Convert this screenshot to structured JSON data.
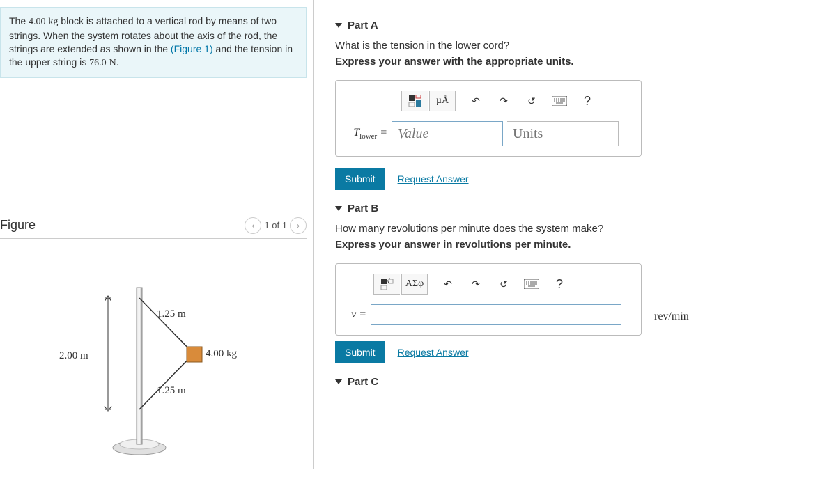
{
  "problem": {
    "mass": "4.00",
    "mass_unit": "kg",
    "text_before_fig": "The 4.00 kg block is attached to a vertical rod by means of two strings. When the system rotates about the axis of the rod, the strings are extended as shown in the ",
    "fig_link_text": "(Figure 1)",
    "text_after_fig": " and the tension in the upper string is 76.0 N.",
    "upper_tension": "76.0",
    "tension_unit": "N"
  },
  "figure": {
    "title": "Figure",
    "pager": "1 of 1",
    "dim_total": "2.00 m",
    "dim_upper": "1.25 m",
    "dim_lower": "1.25 m",
    "block_label": "4.00 kg"
  },
  "partA": {
    "header": "Part A",
    "question": "What is the tension in the lower cord?",
    "instruction": "Express your answer with the appropriate units.",
    "var_label": "Tlower",
    "value_placeholder": "Value",
    "units_placeholder": "Units",
    "submit": "Submit",
    "request": "Request Answer",
    "toolbar": {
      "units_btn": "µÅ",
      "undo": "↶",
      "redo": "↷",
      "reset": "↺",
      "keyboard": "⌨",
      "help": "?"
    }
  },
  "partB": {
    "header": "Part B",
    "question": "How many revolutions per minute does the system make?",
    "instruction": "Express your answer in revolutions per minute.",
    "var_label": "ν =",
    "unit_suffix": "rev/min",
    "submit": "Submit",
    "request": "Request Answer",
    "toolbar": {
      "symbols": "ΑΣφ",
      "undo": "↶",
      "redo": "↷",
      "reset": "↺",
      "keyboard": "⌨",
      "help": "?"
    }
  },
  "partC": {
    "header": "Part C"
  }
}
